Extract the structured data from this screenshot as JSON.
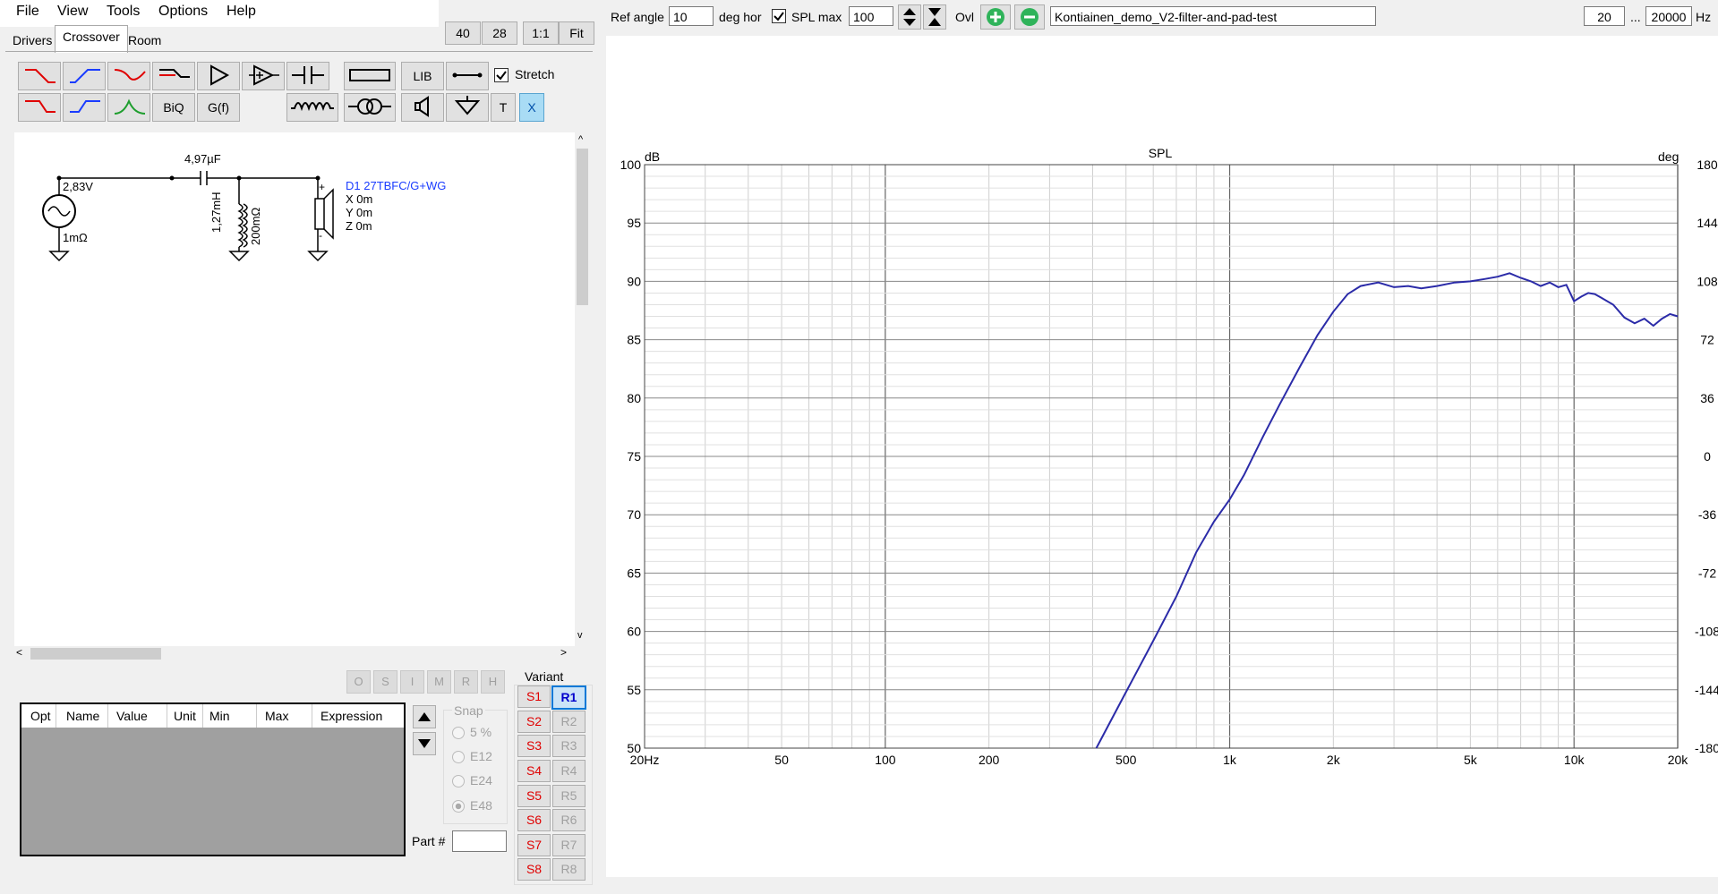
{
  "menu": [
    "File",
    "View",
    "Tools",
    "Options",
    "Help"
  ],
  "tabs": [
    "Drivers",
    "Crossover",
    "Room"
  ],
  "zoom": [
    "40",
    "28",
    "1:1",
    "Fit"
  ],
  "toolbar": {
    "lib_label": "LIB",
    "stretch_label": "Stretch",
    "biq_label": "BiQ",
    "gf_label": "G(f)",
    "t_label": "T",
    "x_label": "X"
  },
  "schematic": {
    "source_voltage": "2,83V",
    "source_resistance": "1mΩ",
    "capacitor": "4,97µF",
    "inductor": "1,27mH",
    "inductor_resistance": "200mΩ",
    "driver_name": "D1 27TBFC/G+WG",
    "driver_x": "X 0m",
    "driver_y": "Y 0m",
    "driver_z": "Z 0m",
    "plus": "+",
    "minus": "-"
  },
  "opt_buttons": [
    "O",
    "S",
    "I",
    "M",
    "R",
    "H"
  ],
  "table_headers": [
    "Opt",
    "Name",
    "Value",
    "Unit",
    "Min",
    "Max",
    "Expression"
  ],
  "snap": {
    "title": "Snap",
    "options": [
      "5 %",
      "E12",
      "E24",
      "E48"
    ]
  },
  "part_label": "Part #",
  "variant": {
    "title": "Variant",
    "s": [
      "S1",
      "S2",
      "S3",
      "S4",
      "S5",
      "S6",
      "S7",
      "S8"
    ],
    "r": [
      "R1",
      "R2",
      "R3",
      "R4",
      "R5",
      "R6",
      "R7",
      "R8"
    ]
  },
  "topbar": {
    "ref_angle_label": "Ref angle",
    "ref_angle_value": "10",
    "deg_hor_label": "deg hor",
    "spl_max_label": "SPL max",
    "spl_max_value": "100",
    "ovl_label": "Ovl",
    "overlay_name": "Kontiainen_demo_V2-filter-and-pad-test",
    "freq_min": "20",
    "freq_sep": "...",
    "freq_max": "20000",
    "hz_label": "Hz"
  },
  "chart_data": {
    "type": "line",
    "title": "SPL",
    "ylabel_left": "dB",
    "ylabel_right": "deg",
    "xscale": "log",
    "xlim": [
      20,
      20000
    ],
    "ylim": [
      50,
      100
    ],
    "y2lim": [
      -180,
      180
    ],
    "x_ticks": [
      "20Hz",
      "50",
      "100",
      "200",
      "500",
      "1k",
      "2k",
      "5k",
      "10k",
      "20k"
    ],
    "x_tick_values": [
      20,
      50,
      100,
      200,
      500,
      1000,
      2000,
      5000,
      10000,
      20000
    ],
    "y_ticks": [
      100,
      95,
      90,
      85,
      80,
      75,
      70,
      65,
      60,
      55,
      50
    ],
    "y2_ticks": [
      "180",
      "144",
      "108",
      "72",
      "36",
      "0",
      "-36",
      "-72",
      "-108",
      "-144",
      "-180"
    ],
    "grid": true,
    "color": "#2b2ba8",
    "series": [
      {
        "x": [
          410,
          500,
          600,
          700,
          800,
          900,
          1000,
          1100,
          1250,
          1400,
          1600,
          1800,
          2000,
          2200,
          2400,
          2700,
          3000,
          3300,
          3600,
          4000,
          4500,
          5000,
          5500,
          6000,
          6500,
          7000,
          7500,
          8000,
          8500,
          9000,
          9500,
          10000,
          10500,
          11000,
          11500,
          12000,
          13000,
          14000,
          15000,
          16000,
          17000,
          18000,
          19000,
          20000
        ],
        "y": [
          50,
          54.8,
          59.2,
          63,
          66.8,
          69.4,
          71.3,
          73.4,
          76.7,
          79.5,
          82.7,
          85.4,
          87.4,
          88.9,
          89.6,
          89.9,
          89.5,
          89.6,
          89.4,
          89.6,
          89.9,
          90.0,
          90.2,
          90.4,
          90.7,
          90.3,
          90.0,
          89.6,
          89.9,
          89.5,
          89.7,
          88.3,
          88.7,
          89.0,
          88.9,
          88.6,
          88.0,
          86.9,
          86.4,
          86.8,
          86.2,
          86.8,
          87.2,
          87.0
        ]
      }
    ]
  }
}
